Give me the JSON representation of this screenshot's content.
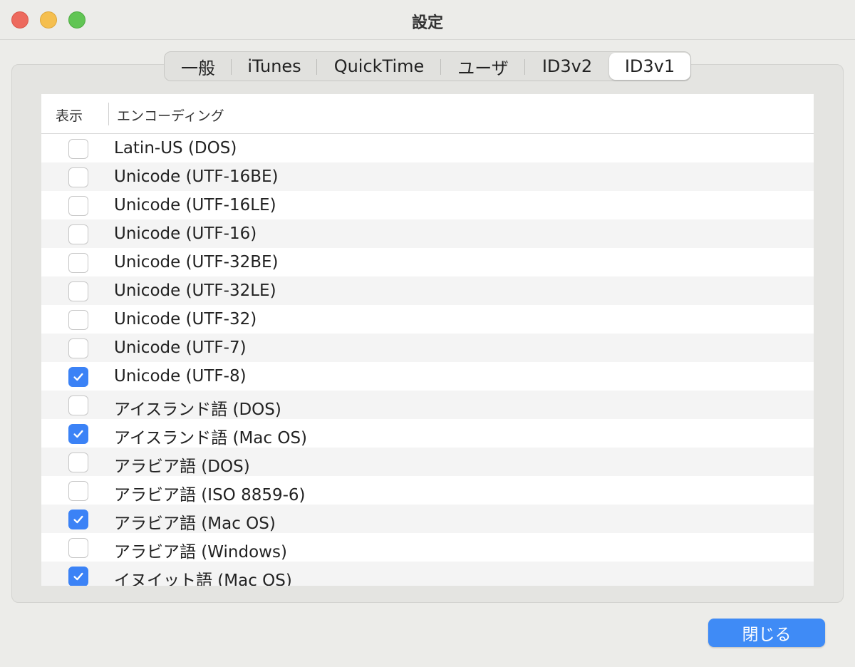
{
  "window": {
    "title": "設定"
  },
  "tabs": [
    {
      "label": "一般",
      "active": false
    },
    {
      "label": "iTunes",
      "active": false
    },
    {
      "label": "QuickTime",
      "active": false
    },
    {
      "label": "ユーザ",
      "active": false
    },
    {
      "label": "ID3v2",
      "active": false
    },
    {
      "label": "ID3v1",
      "active": true
    }
  ],
  "table": {
    "columns": [
      "表示",
      "エンコーディング"
    ],
    "rows": [
      {
        "label": "Latin-US (DOS)",
        "checked": false
      },
      {
        "label": "Unicode (UTF-16BE)",
        "checked": false
      },
      {
        "label": "Unicode (UTF-16LE)",
        "checked": false
      },
      {
        "label": "Unicode (UTF-16)",
        "checked": false
      },
      {
        "label": "Unicode (UTF-32BE)",
        "checked": false
      },
      {
        "label": "Unicode (UTF-32LE)",
        "checked": false
      },
      {
        "label": "Unicode (UTF-32)",
        "checked": false
      },
      {
        "label": "Unicode (UTF-7)",
        "checked": false
      },
      {
        "label": "Unicode (UTF-8)",
        "checked": true
      },
      {
        "label": "アイスランド語 (DOS)",
        "checked": false
      },
      {
        "label": "アイスランド語 (Mac OS)",
        "checked": true
      },
      {
        "label": "アラビア語 (DOS)",
        "checked": false
      },
      {
        "label": "アラビア語 (ISO 8859-6)",
        "checked": false
      },
      {
        "label": "アラビア語 (Mac OS)",
        "checked": true
      },
      {
        "label": "アラビア語 (Windows)",
        "checked": false
      },
      {
        "label": "イヌイット語 (Mac OS)",
        "checked": true
      }
    ]
  },
  "footer": {
    "close_label": "閉じる"
  },
  "colors": {
    "accent": "#3b82f6"
  }
}
